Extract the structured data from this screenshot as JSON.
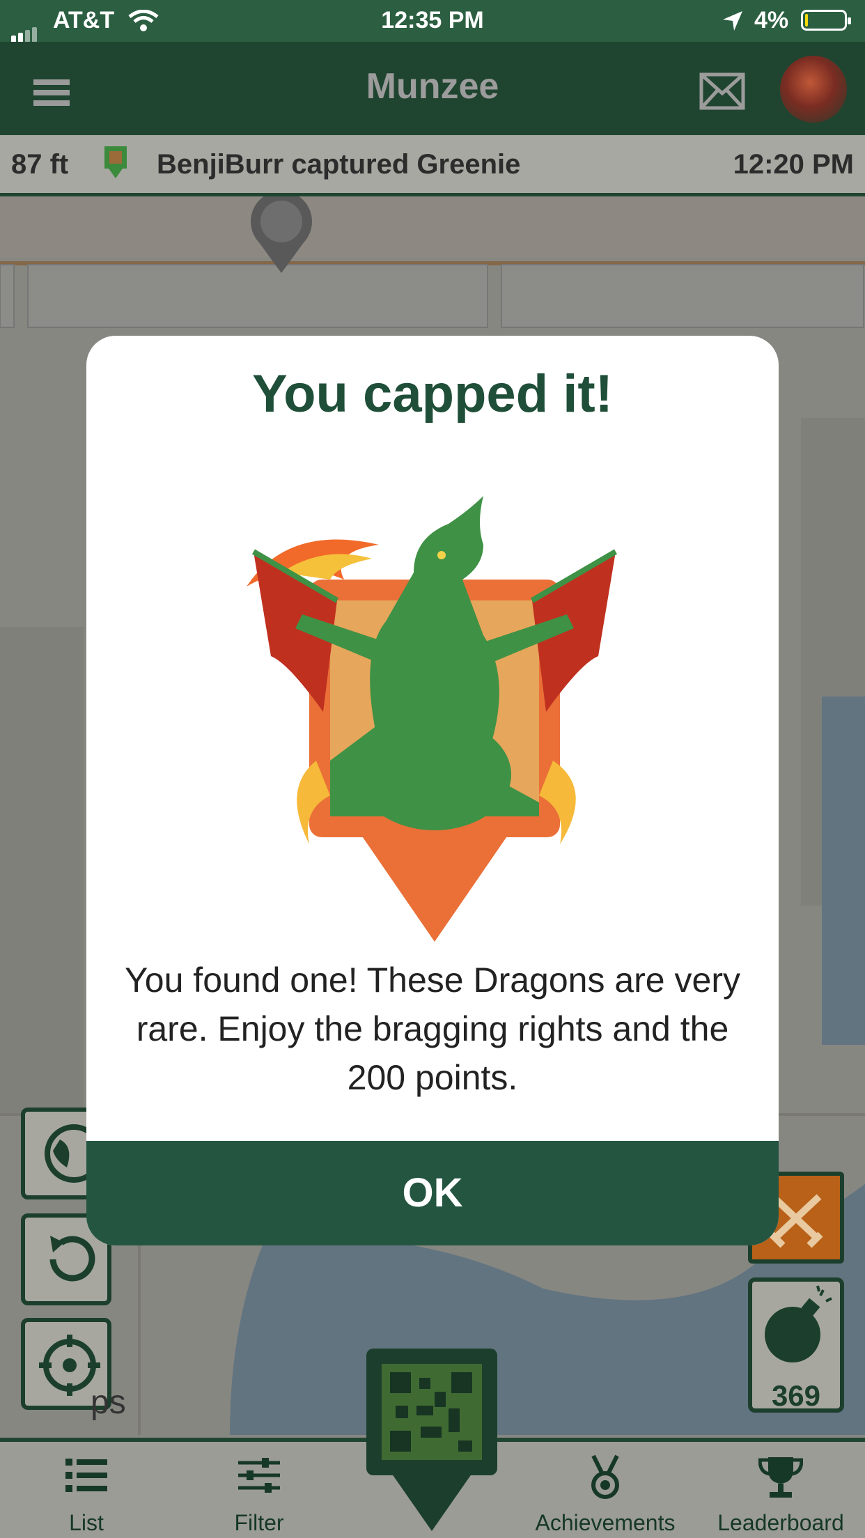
{
  "status_bar": {
    "carrier": "AT&T",
    "time": "12:35 PM",
    "battery": "4%"
  },
  "nav": {
    "title": "Munzee"
  },
  "activity": {
    "distance": "87 ft",
    "message": "BenjiBurr captured Greenie",
    "time": "12:20 PM"
  },
  "dialog": {
    "heading": "You capped it!",
    "body": "You found one! These Dragons are very rare. Enjoy the bragging rights and the 200 points.",
    "ok_label": "OK"
  },
  "map": {
    "partial_text": "ps"
  },
  "side_controls": {
    "bomb_count": "369"
  },
  "tabs": [
    {
      "label": "List",
      "icon": "list-icon"
    },
    {
      "label": "Filter",
      "icon": "filter-icon"
    },
    {
      "label": "Achievements",
      "icon": "medal-icon"
    },
    {
      "label": "Leaderboard",
      "icon": "trophy-icon"
    }
  ],
  "colors": {
    "brand_dark": "#1f4530",
    "button_green": "#245540",
    "heading_green": "#1f4f38",
    "orange": "#b96118"
  }
}
